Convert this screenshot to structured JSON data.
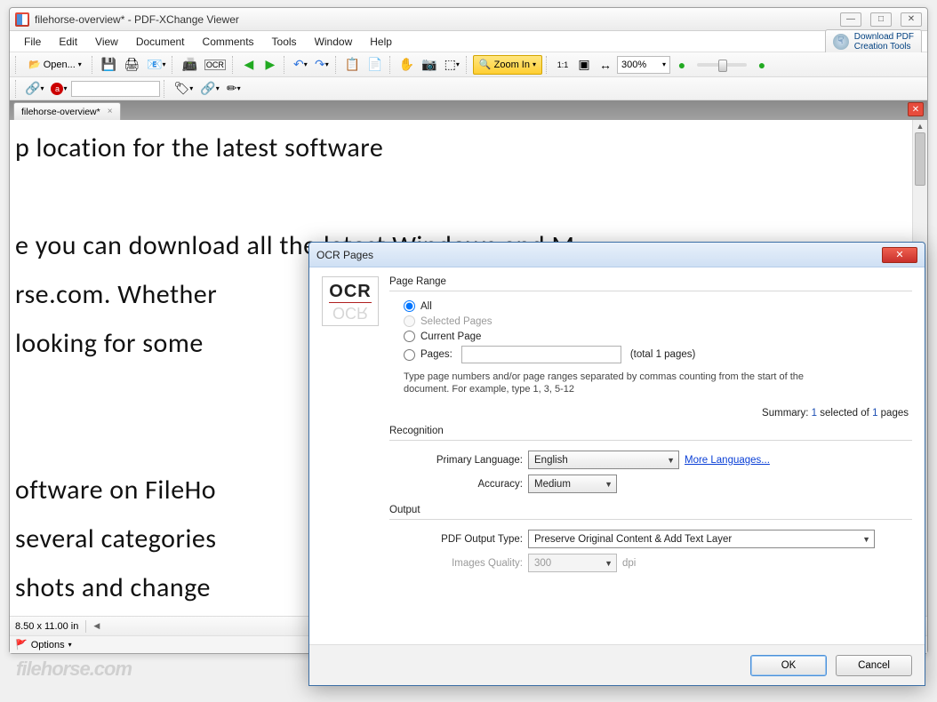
{
  "window": {
    "title": "filehorse-overview* - PDF-XChange Viewer"
  },
  "menubar": [
    "File",
    "Edit",
    "View",
    "Document",
    "Comments",
    "Tools",
    "Window",
    "Help"
  ],
  "download_button": {
    "line1": "Download PDF",
    "line2": "Creation Tools"
  },
  "toolbar": {
    "open_label": "Open...",
    "ocr_label": "OCR",
    "zoom_in_label": "Zoom In",
    "zoom_pct": "300%"
  },
  "tabs": {
    "name": "filehorse-overview*"
  },
  "document_text": "p location for the latest software\n\ne you can download all the latest Windows and M\nrse.com. Whether\n   looking for some\n\n\noftware on FileHo\nseveral categories\nshots and change",
  "statusbar": {
    "page_size": "8.50 x 11.00 in",
    "options_label": "Options"
  },
  "dialog": {
    "title": "OCR Pages",
    "page_range": {
      "group": "Page Range",
      "all": "All",
      "selected": "Selected Pages",
      "current": "Current Page",
      "pages": "Pages:",
      "total": "(total 1 pages)",
      "hint": "Type page numbers and/or page ranges separated by commas counting from the start of the document. For example, type 1, 3, 5-12",
      "summary_prefix": "Summary: ",
      "summary_sel": "1",
      "summary_mid": " selected of ",
      "summary_tot": "1",
      "summary_suffix": " pages"
    },
    "recognition": {
      "group": "Recognition",
      "primary_lang_label": "Primary Language:",
      "primary_lang_value": "English",
      "more_lang": "More Languages...",
      "accuracy_label": "Accuracy:",
      "accuracy_value": "Medium"
    },
    "output": {
      "group": "Output",
      "type_label": "PDF Output Type:",
      "type_value": "Preserve Original Content & Add Text Layer",
      "quality_label": "Images Quality:",
      "quality_value": "300",
      "quality_unit": "dpi"
    },
    "buttons": {
      "ok": "OK",
      "cancel": "Cancel"
    }
  },
  "watermark": "filehorse.com"
}
